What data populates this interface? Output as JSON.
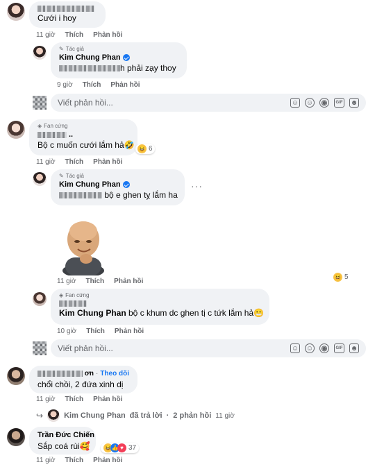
{
  "comment1": {
    "text": "Cưới i hoy",
    "time": "11 giờ",
    "like": "Thích",
    "reply": "Phản hồi"
  },
  "reply1": {
    "badge": "Tác giả",
    "name": "Kim Chung Phan",
    "text_suffix": "h phải zạy thoy",
    "time": "9 giờ",
    "like": "Thích",
    "reply": "Phản hồi"
  },
  "reply_box_1": {
    "placeholder": "Viết phản hồi..."
  },
  "comment2": {
    "badge": "Fan cứng",
    "name_suffix": "..",
    "text": "Bộ c muốn cưới lắm hả🤣",
    "reaction_count": "6",
    "time": "11 giờ",
    "like": "Thích",
    "reply": "Phản hồi"
  },
  "reply2": {
    "badge": "Tác giả",
    "name": "Kim Chung Phan",
    "text_suffix": "bộ e ghen tỵ lắm ha",
    "time": "11 giờ",
    "like": "Thích",
    "reply": "Phản hồi",
    "reaction_count": "5"
  },
  "reply3": {
    "badge": "Fan cứng",
    "mention": "Kim Chung Phan",
    "text": " bộ c khum dc ghen tị c tứk lắm hả😬",
    "time": "10 giờ",
    "like": "Thích",
    "reply": "Phản hồi"
  },
  "reply_box_2": {
    "placeholder": "Viết phản hồi..."
  },
  "comment3": {
    "name_suffix": "ơn",
    "follow": "Theo dõi",
    "text": "chổi chồi, 2 đứa xinh dị",
    "time": "11 giờ",
    "like": "Thích",
    "reply": "Phản hồi"
  },
  "replied_summary": {
    "name": "Kim Chung Phan",
    "action": "đã trả lời",
    "count": "2 phản hồi",
    "time": "11 giờ"
  },
  "comment4": {
    "name": "Trần Đức Chiến",
    "text": "Sắp coá rùi🥰",
    "reaction_count": "37",
    "time": "11 giờ",
    "like": "Thích",
    "reply": "Phản hồi"
  },
  "colors": {
    "bubble": "#f0f2f5",
    "secondary_text": "#65676b",
    "verified": "#1877f2",
    "follow": "#1877f2"
  }
}
